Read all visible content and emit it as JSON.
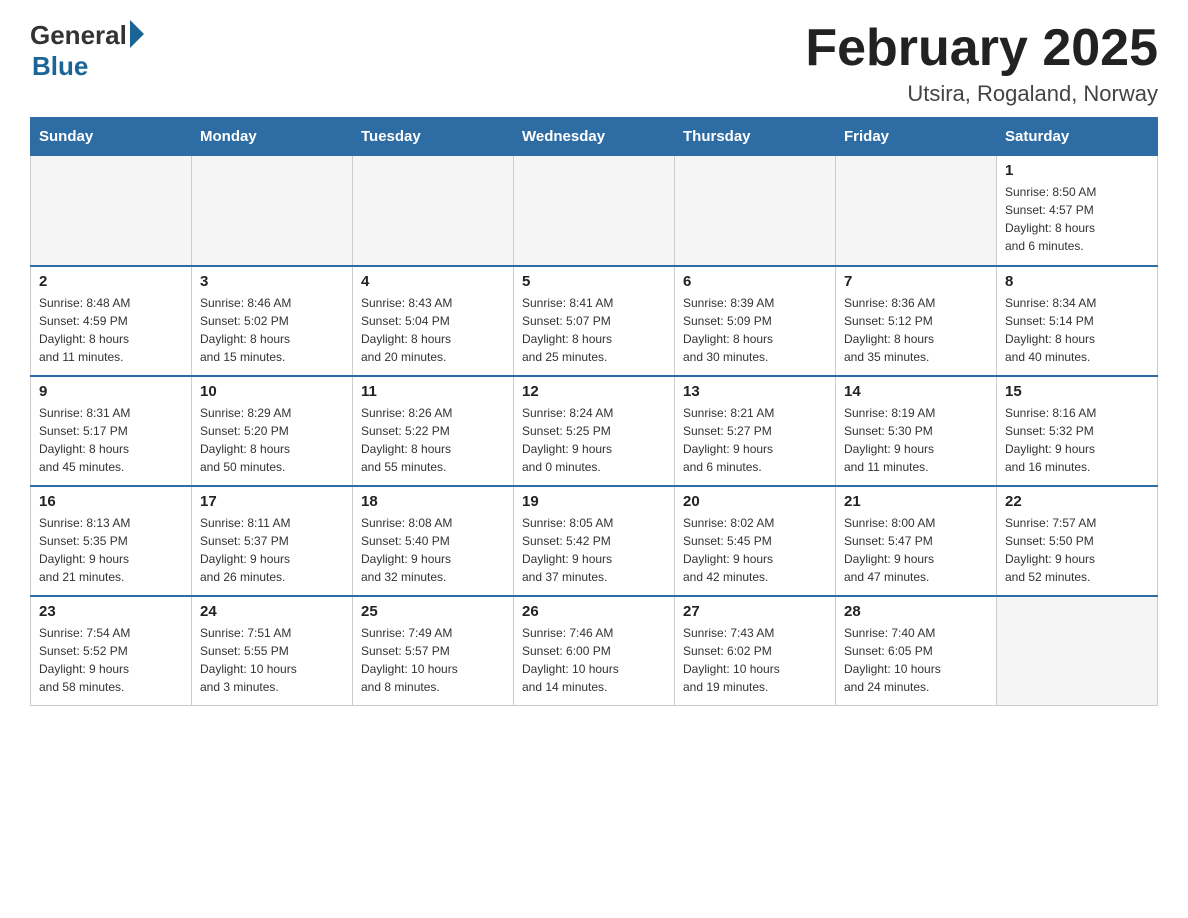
{
  "header": {
    "logo_general": "General",
    "logo_blue": "Blue",
    "title": "February 2025",
    "location": "Utsira, Rogaland, Norway"
  },
  "weekdays": [
    "Sunday",
    "Monday",
    "Tuesday",
    "Wednesday",
    "Thursday",
    "Friday",
    "Saturday"
  ],
  "weeks": [
    [
      {
        "day": "",
        "info": ""
      },
      {
        "day": "",
        "info": ""
      },
      {
        "day": "",
        "info": ""
      },
      {
        "day": "",
        "info": ""
      },
      {
        "day": "",
        "info": ""
      },
      {
        "day": "",
        "info": ""
      },
      {
        "day": "1",
        "info": "Sunrise: 8:50 AM\nSunset: 4:57 PM\nDaylight: 8 hours\nand 6 minutes."
      }
    ],
    [
      {
        "day": "2",
        "info": "Sunrise: 8:48 AM\nSunset: 4:59 PM\nDaylight: 8 hours\nand 11 minutes."
      },
      {
        "day": "3",
        "info": "Sunrise: 8:46 AM\nSunset: 5:02 PM\nDaylight: 8 hours\nand 15 minutes."
      },
      {
        "day": "4",
        "info": "Sunrise: 8:43 AM\nSunset: 5:04 PM\nDaylight: 8 hours\nand 20 minutes."
      },
      {
        "day": "5",
        "info": "Sunrise: 8:41 AM\nSunset: 5:07 PM\nDaylight: 8 hours\nand 25 minutes."
      },
      {
        "day": "6",
        "info": "Sunrise: 8:39 AM\nSunset: 5:09 PM\nDaylight: 8 hours\nand 30 minutes."
      },
      {
        "day": "7",
        "info": "Sunrise: 8:36 AM\nSunset: 5:12 PM\nDaylight: 8 hours\nand 35 minutes."
      },
      {
        "day": "8",
        "info": "Sunrise: 8:34 AM\nSunset: 5:14 PM\nDaylight: 8 hours\nand 40 minutes."
      }
    ],
    [
      {
        "day": "9",
        "info": "Sunrise: 8:31 AM\nSunset: 5:17 PM\nDaylight: 8 hours\nand 45 minutes."
      },
      {
        "day": "10",
        "info": "Sunrise: 8:29 AM\nSunset: 5:20 PM\nDaylight: 8 hours\nand 50 minutes."
      },
      {
        "day": "11",
        "info": "Sunrise: 8:26 AM\nSunset: 5:22 PM\nDaylight: 8 hours\nand 55 minutes."
      },
      {
        "day": "12",
        "info": "Sunrise: 8:24 AM\nSunset: 5:25 PM\nDaylight: 9 hours\nand 0 minutes."
      },
      {
        "day": "13",
        "info": "Sunrise: 8:21 AM\nSunset: 5:27 PM\nDaylight: 9 hours\nand 6 minutes."
      },
      {
        "day": "14",
        "info": "Sunrise: 8:19 AM\nSunset: 5:30 PM\nDaylight: 9 hours\nand 11 minutes."
      },
      {
        "day": "15",
        "info": "Sunrise: 8:16 AM\nSunset: 5:32 PM\nDaylight: 9 hours\nand 16 minutes."
      }
    ],
    [
      {
        "day": "16",
        "info": "Sunrise: 8:13 AM\nSunset: 5:35 PM\nDaylight: 9 hours\nand 21 minutes."
      },
      {
        "day": "17",
        "info": "Sunrise: 8:11 AM\nSunset: 5:37 PM\nDaylight: 9 hours\nand 26 minutes."
      },
      {
        "day": "18",
        "info": "Sunrise: 8:08 AM\nSunset: 5:40 PM\nDaylight: 9 hours\nand 32 minutes."
      },
      {
        "day": "19",
        "info": "Sunrise: 8:05 AM\nSunset: 5:42 PM\nDaylight: 9 hours\nand 37 minutes."
      },
      {
        "day": "20",
        "info": "Sunrise: 8:02 AM\nSunset: 5:45 PM\nDaylight: 9 hours\nand 42 minutes."
      },
      {
        "day": "21",
        "info": "Sunrise: 8:00 AM\nSunset: 5:47 PM\nDaylight: 9 hours\nand 47 minutes."
      },
      {
        "day": "22",
        "info": "Sunrise: 7:57 AM\nSunset: 5:50 PM\nDaylight: 9 hours\nand 52 minutes."
      }
    ],
    [
      {
        "day": "23",
        "info": "Sunrise: 7:54 AM\nSunset: 5:52 PM\nDaylight: 9 hours\nand 58 minutes."
      },
      {
        "day": "24",
        "info": "Sunrise: 7:51 AM\nSunset: 5:55 PM\nDaylight: 10 hours\nand 3 minutes."
      },
      {
        "day": "25",
        "info": "Sunrise: 7:49 AM\nSunset: 5:57 PM\nDaylight: 10 hours\nand 8 minutes."
      },
      {
        "day": "26",
        "info": "Sunrise: 7:46 AM\nSunset: 6:00 PM\nDaylight: 10 hours\nand 14 minutes."
      },
      {
        "day": "27",
        "info": "Sunrise: 7:43 AM\nSunset: 6:02 PM\nDaylight: 10 hours\nand 19 minutes."
      },
      {
        "day": "28",
        "info": "Sunrise: 7:40 AM\nSunset: 6:05 PM\nDaylight: 10 hours\nand 24 minutes."
      },
      {
        "day": "",
        "info": ""
      }
    ]
  ]
}
